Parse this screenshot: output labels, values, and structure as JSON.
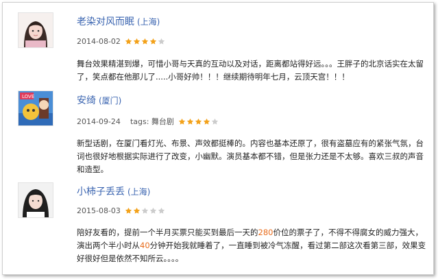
{
  "reviews": [
    {
      "user": "老染对风而眠",
      "location": "(上海)",
      "date": "2014-08-02",
      "tags": "",
      "rating": 4,
      "content_parts": [
        {
          "t": "舞台效果精湛到爆，可惜小哥与天真的互动以及对话，距离都站得好远。。。王胖子的北京话实在太留了，笑点都在他那儿了.....小哥好帅！！！继续期待明年七月，云顶天宫！！！",
          "hl": false
        }
      ]
    },
    {
      "user": "安绮",
      "location": "(厦门)",
      "date": "2014-09-24",
      "tags": "tags: 舞台剧",
      "rating": 4,
      "content_parts": [
        {
          "t": "新型话剧，在厦门看灯光、布景、声效都挺棒的。内容也基本还原了，很有盗墓应有的紧张气氛，台词也很好地根据实际进行了改变，小幽默。演员基本都不错，但是张力还是不太够。喜欢三叔的声音和造型。",
          "hl": false
        }
      ]
    },
    {
      "user": "小柿子丢丢",
      "location": "(上海)",
      "date": "2015-08-03",
      "tags": "",
      "rating": 2,
      "content_parts": [
        {
          "t": "陪好友看的，提前一个半月买票只能买到最后一天的",
          "hl": false
        },
        {
          "t": "280",
          "hl": true
        },
        {
          "t": "价位的票子了，不得不得腐女的威力强大，演出两个半小时从",
          "hl": false
        },
        {
          "t": "40",
          "hl": true
        },
        {
          "t": "分钟开始我就睡着了，一直睡到被冷气冻醒，看过第二部这次看第三部，效果变好很好但是依然不知所云。。。。",
          "hl": false
        }
      ]
    }
  ],
  "colors": {
    "link": "#3a64b0",
    "star_on": "#f3a21b",
    "star_off": "#cccccc",
    "highlight": "#e86b1a"
  },
  "icons": [
    "star-icon"
  ]
}
